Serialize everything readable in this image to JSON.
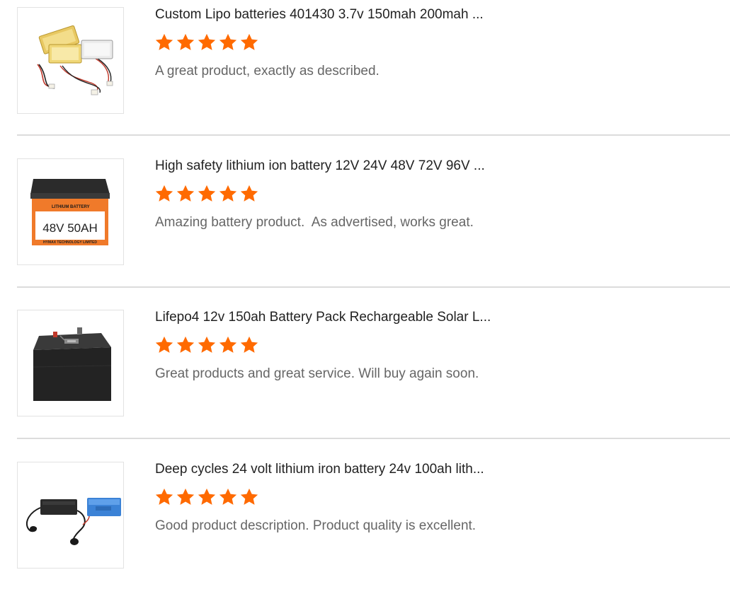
{
  "colors": {
    "star": "#ff6a00",
    "title": "#222222",
    "comment": "#666666",
    "divider": "#dcdcdc"
  },
  "reviews": [
    {
      "title": "Custom Lipo batteries 401430 3.7v 150mah 200mah ...",
      "rating": 5,
      "comment": "A great product, exactly as described.",
      "thumbnail": "lipo-pouch-cells-image"
    },
    {
      "title": "High safety lithium ion battery 12V 24V 48V 72V 96V ...",
      "rating": 5,
      "comment": "Amazing battery product.  As advertised, works great.",
      "thumbnail": "48v-battery-box-image",
      "thumbnail_text": {
        "header": "LITHIUM BATTERY",
        "rating_label": "48V 50AH",
        "footer": "HYMAX TECHNOLOGY LIMITED"
      }
    },
    {
      "title": "Lifepo4 12v 150ah Battery Pack Rechargeable Solar L...",
      "rating": 5,
      "comment": "Great products and great service. Will buy again soon.",
      "thumbnail": "black-battery-box-image"
    },
    {
      "title": "Deep cycles 24 volt lithium iron battery 24v 100ah lith...",
      "rating": 5,
      "comment": "Good product description. Product quality is excellent.",
      "thumbnail": "battery-pack-with-charger-image"
    }
  ]
}
